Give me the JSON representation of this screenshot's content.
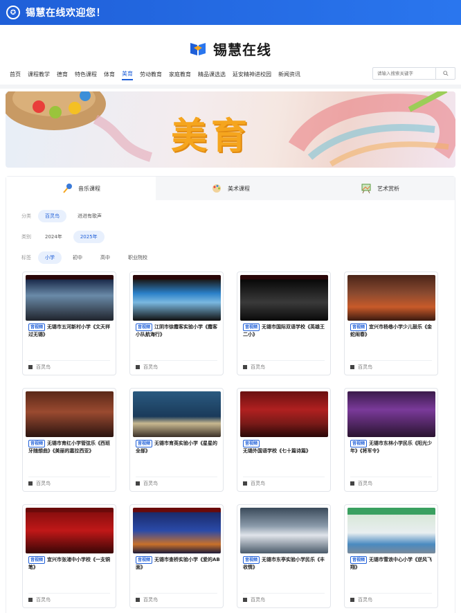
{
  "topbar": {
    "welcome": "锡慧在线欢迎您！",
    "emblem_icon": "school-emblem-icon"
  },
  "header": {
    "logo_text": "锡慧在线",
    "logo_icon": "book-logo-icon"
  },
  "nav": {
    "items": [
      "首页",
      "课程教学",
      "德育",
      "特色课程",
      "体育",
      "美育",
      "劳动教育",
      "家庭教育",
      "精品课选选",
      "延安精神进校园",
      "新闻资讯"
    ],
    "active": "美育"
  },
  "search": {
    "placeholder": "请输入搜索关键字",
    "icon": "search-icon"
  },
  "banner": {
    "title": "美育"
  },
  "tabs": [
    {
      "label": "音乐课程",
      "icon": "microphone-icon",
      "active": true
    },
    {
      "label": "美术课程",
      "icon": "palette-icon",
      "active": false
    },
    {
      "label": "艺术赏析",
      "icon": "easel-icon",
      "active": false
    }
  ],
  "filters": [
    {
      "label": "分类",
      "options": [
        "百灵鸟",
        "进进有歌声"
      ],
      "selected": "百灵鸟"
    },
    {
      "label": "类别",
      "options": [
        "2024年",
        "2025年"
      ],
      "selected": "2025年"
    },
    {
      "label": "标签",
      "options": [
        "小学",
        "初中",
        "高中",
        "职业院校"
      ],
      "selected": "小学"
    }
  ],
  "cards": [
    {
      "tag": "音视频",
      "title": "无锡市五河新村小学《文天祥过无锡》",
      "category": "百灵鸟"
    },
    {
      "tag": "音视频",
      "title": "江阴市徐霞客实验小学《霞客小队航海行》",
      "category": "百灵鸟"
    },
    {
      "tag": "音视频",
      "title": "无锡市国际双语学校《英雄王二小》",
      "category": "百灵鸟"
    },
    {
      "tag": "音视频",
      "title": "宜兴市杨巷小学少儿鼓乐《金蛇闹春》",
      "category": "百灵鸟"
    },
    {
      "tag": "音视频",
      "title": "无锡市育红小学管弦乐《西班牙随想曲》《美丽的嘉拉西亚》",
      "category": "百灵鸟"
    },
    {
      "tag": "音视频",
      "title": "无锡市育英实验小学《星星的全部》",
      "category": "百灵鸟"
    },
    {
      "tag": "音视频",
      "title": "无锡外国语学校《七十篇诗篇》",
      "category": "百灵鸟"
    },
    {
      "tag": "音视频",
      "title": "无锡市东林小学民乐《阳光少年》《将军令》",
      "category": "百灵鸟"
    },
    {
      "tag": "音视频",
      "title": "宜兴市张渚中小学校《一支铜笔》",
      "category": "百灵鸟"
    },
    {
      "tag": "音视频",
      "title": "无锡市查桥实验小学《爱的AB面》",
      "category": "百灵鸟"
    },
    {
      "tag": "音视频",
      "title": "无锡市东亭实验小学民乐《丰收情》",
      "category": "百灵鸟"
    },
    {
      "tag": "音视频",
      "title": "无锡市雪浪中心小学《逆风飞翔》",
      "category": "百灵鸟"
    }
  ],
  "colors": {
    "primary": "#1f5fd8",
    "banner_title": "#f5a51e"
  }
}
